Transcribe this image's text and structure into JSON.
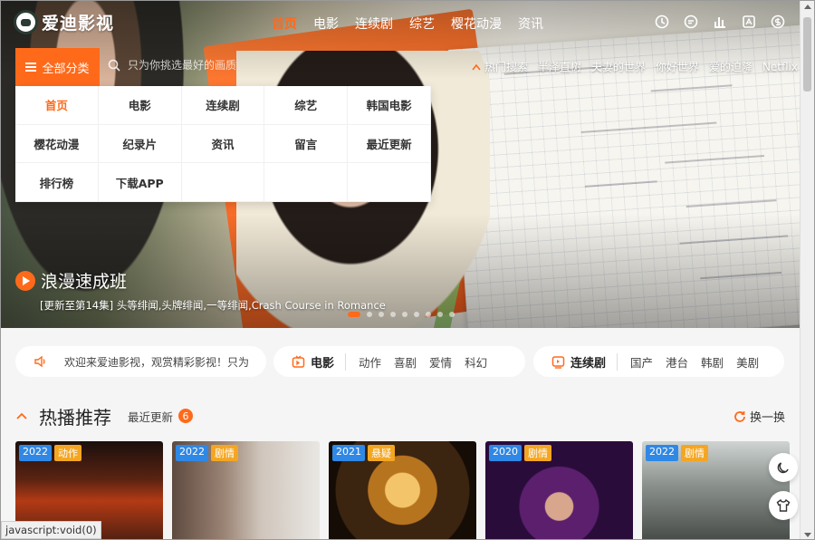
{
  "brand": {
    "name": "爱迪影视"
  },
  "nav": {
    "links": [
      "首页",
      "电影",
      "连续剧",
      "综艺",
      "樱花动漫",
      "资讯"
    ],
    "icons": [
      "clock-icon",
      "chat-icon",
      "chart-icon",
      "app-icon",
      "money-icon"
    ]
  },
  "category_button": "全部分类",
  "search": {
    "placeholder": "只为你挑选最好的画质"
  },
  "hot_search": {
    "label": "热门搜索",
    "items": [
      "半泽直树",
      "夫妻的世界",
      "你好世界",
      "爱的迫降",
      "Netflix"
    ]
  },
  "dropdown": {
    "items": [
      "首页",
      "电影",
      "连续剧",
      "综艺",
      "韩国电影",
      "樱花动漫",
      "纪录片",
      "资讯",
      "留言",
      "最近更新",
      "排行榜",
      "下载APP"
    ]
  },
  "banner": {
    "title": "浪漫速成班",
    "subtitle": "[更新至第14集] 头等绯闻,头牌绯闻,一等绯闻,Crash Course in Romance"
  },
  "notice": {
    "text": "欢迎来爱迪影视，观赏精彩影视！只为"
  },
  "movie_bar": {
    "label": "电影",
    "items": [
      "动作",
      "喜剧",
      "爱情",
      "科幻"
    ]
  },
  "series_bar": {
    "label": "连续剧",
    "items": [
      "国产",
      "港台",
      "韩剧",
      "美剧"
    ]
  },
  "section": {
    "title": "热播推荐",
    "sub_label": "最近更新",
    "count": "6",
    "refresh": "换一换"
  },
  "cards": [
    {
      "year": "2022",
      "genre": "动作"
    },
    {
      "year": "2022",
      "genre": "剧情"
    },
    {
      "year": "2021",
      "genre": "悬疑"
    },
    {
      "year": "2020",
      "genre": "剧情"
    },
    {
      "year": "2022",
      "genre": "剧情"
    }
  ],
  "status": "javascript:void(0)",
  "colors": {
    "accent": "#ff6a1a",
    "year_tag": "#2f88e5",
    "genre_tag": "#f4a622"
  }
}
